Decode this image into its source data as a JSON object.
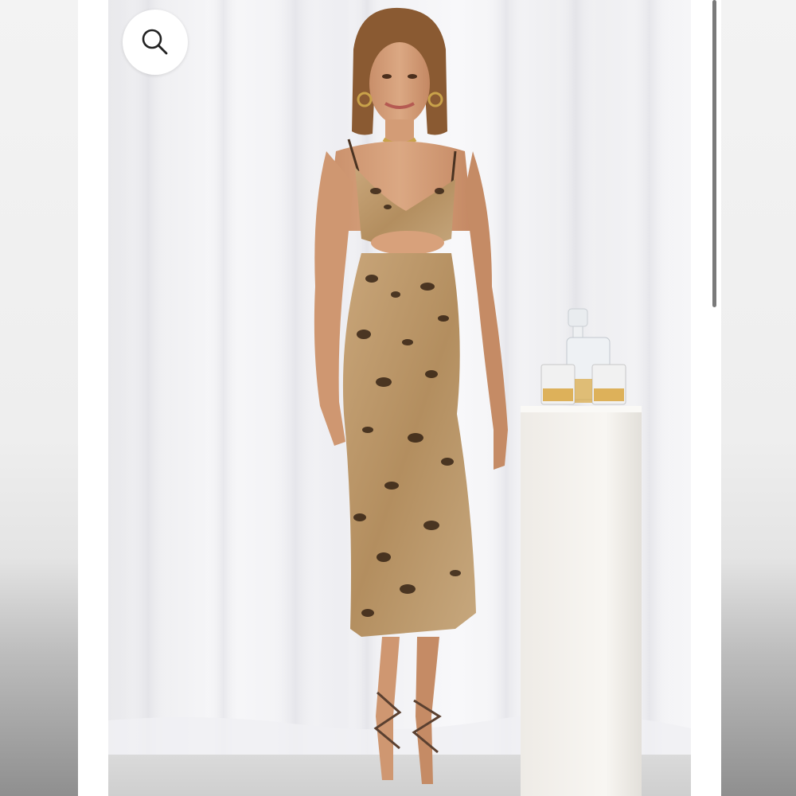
{
  "viewer": {
    "search_button": {
      "icon": "search-icon"
    },
    "image": {
      "subject": "model-in-leopard-print-slip-dress"
    },
    "scrollbar": {
      "position_fraction": 0.0,
      "visible_fraction": 0.386
    }
  },
  "colors": {
    "background": "#ffffff",
    "curtain": "#f2f2f5",
    "dress_base": "#b9976a",
    "dress_spots": "#2b1a0e",
    "pedestal": "#f4f2ee",
    "scroll_thumb": "#7a7a7a"
  }
}
